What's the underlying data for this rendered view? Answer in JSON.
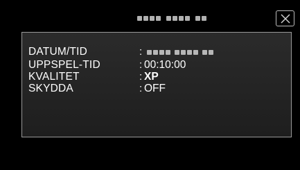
{
  "header": {
    "title_redacted": true,
    "close_icon": "close-icon"
  },
  "info": {
    "rows": [
      {
        "label": "DATUM/TID",
        "colon": ":",
        "value": ""
      },
      {
        "label": "UPPSPEL-TID",
        "colon": ":",
        "value": "00:10:00"
      },
      {
        "label": "KVALITET",
        "colon": ":",
        "value": "XP"
      },
      {
        "label": "SKYDDA",
        "colon": ":",
        "value": "OFF"
      }
    ]
  },
  "colors": {
    "background": "#000000",
    "panel": "#262626",
    "panel_border": "#9a9a9a",
    "text": "#ffffff"
  }
}
